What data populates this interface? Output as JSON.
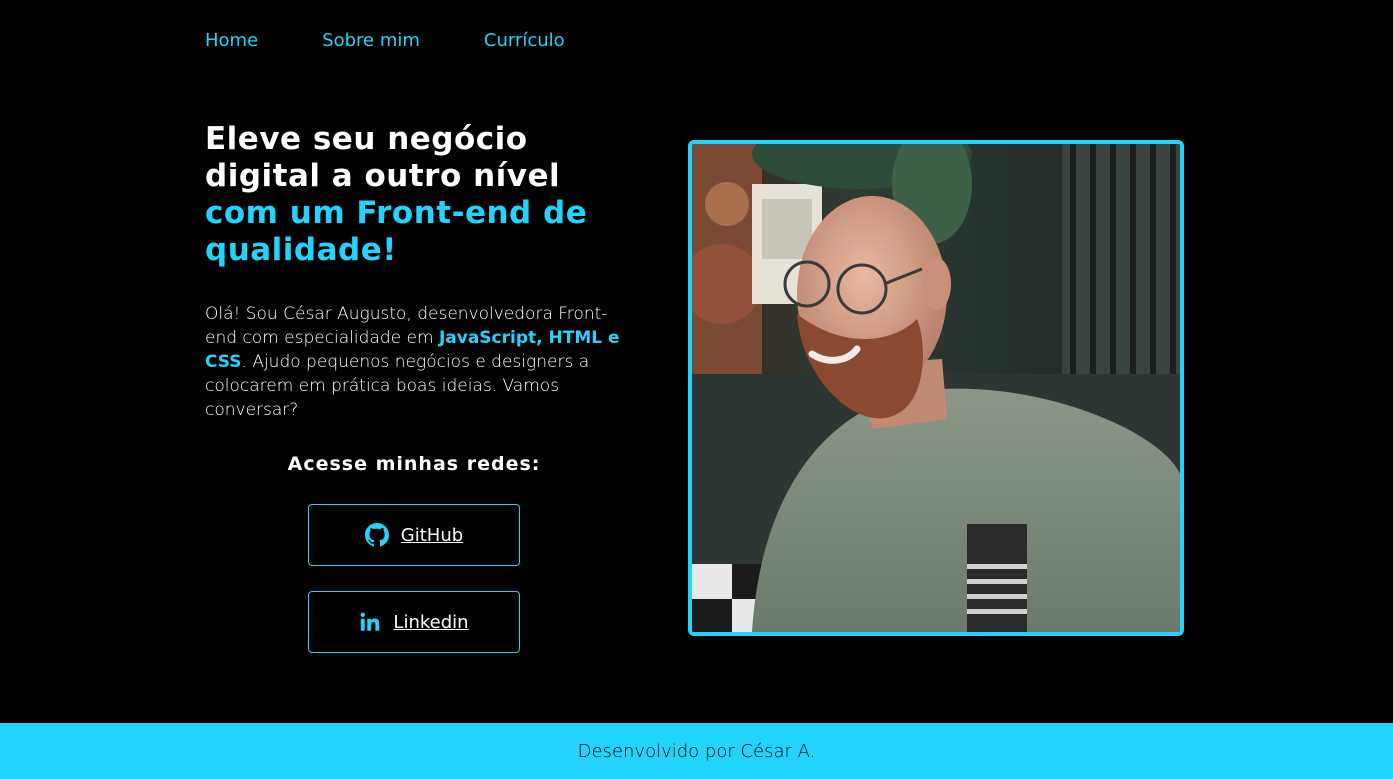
{
  "nav": {
    "items": [
      {
        "label": "Home"
      },
      {
        "label": "Sobre mim"
      },
      {
        "label": "Currículo"
      }
    ]
  },
  "hero": {
    "headline_line1": "Eleve seu negócio",
    "headline_line2": "digital a outro nível",
    "headline_line3": "com um Front-end de",
    "headline_line4": "qualidade!",
    "intro_part1": "Olá! Sou César Augusto, desenvolvedora Front-end com especialidade em ",
    "intro_highlight": "JavaScript, HTML e CSS",
    "intro_part2": ". Ajudo pequenos negócios e designers a colocarem em prática boas ideias. Vamos conversar?"
  },
  "social": {
    "title": "Acesse minhas redes:",
    "github_label": "GitHub",
    "github_icon": "github-icon",
    "linkedin_label": "Linkedin",
    "linkedin_icon": "linkedin-icon"
  },
  "photo": {
    "subject": "portrait-photo"
  },
  "footer": {
    "text": "Desenvolvido por César A."
  },
  "colors": {
    "accent": "#22d4fd",
    "background": "#000000",
    "text": "#ffffff"
  }
}
